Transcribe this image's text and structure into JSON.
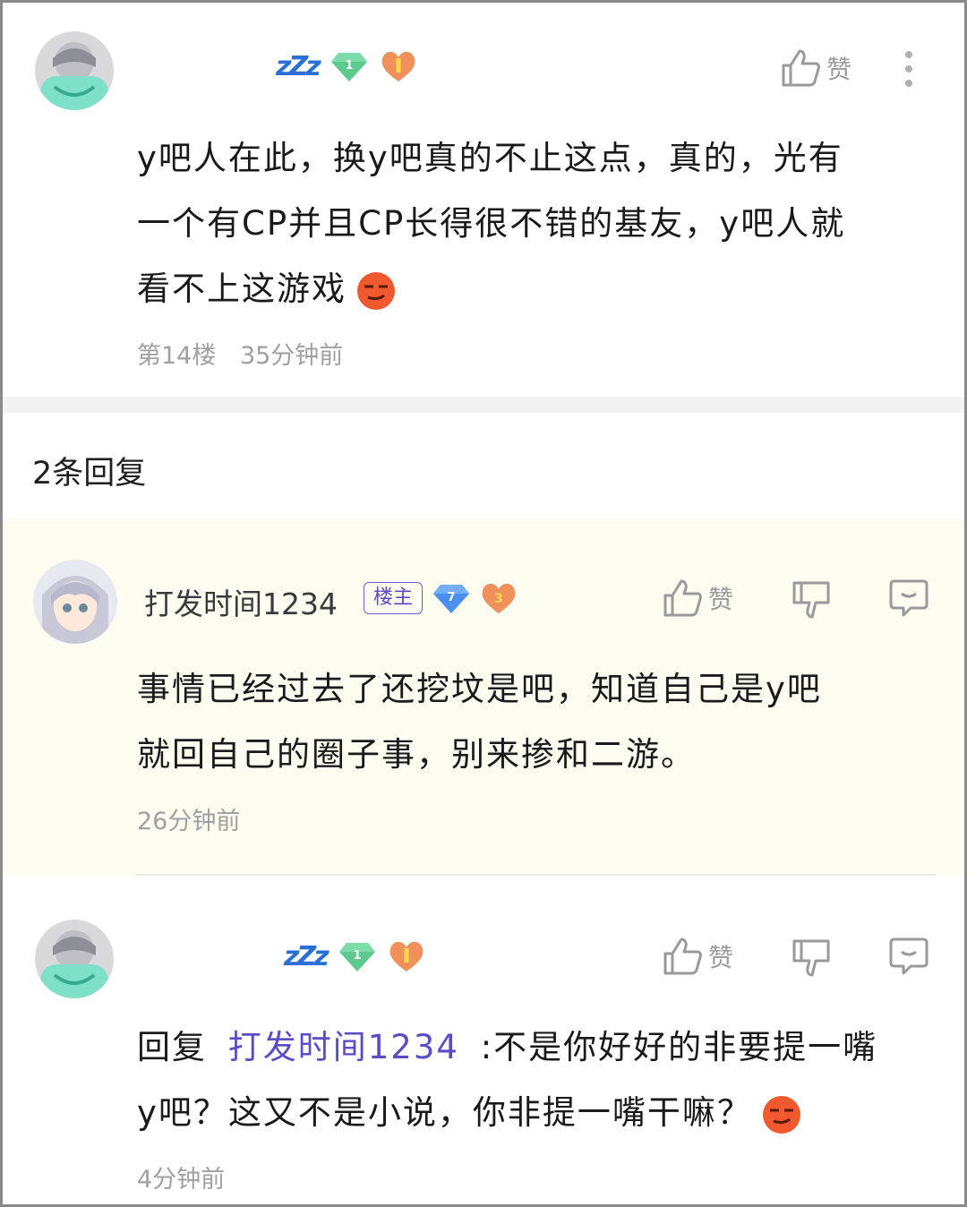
{
  "main_post": {
    "content_lines": [
      "y吧人在此，换y吧真的不止这点，真的，光有",
      "一个有CP并且CP长得很不错的基友，y吧人就",
      "看不上这游戏"
    ],
    "floor": "第14楼",
    "time": "35分钟前",
    "like_label": "赞",
    "level": "1",
    "status_icon_text": "zZz"
  },
  "reply_section": {
    "count_label": "2条回复"
  },
  "replies": [
    {
      "username": "打发时间1234",
      "owner_tag": "楼主",
      "level": "7",
      "heart_level": "3",
      "like_label": "赞",
      "content_lines": [
        "事情已经过去了还挖坟是吧，知道自己是y吧",
        "就回自己的圈子事，别来掺和二游。"
      ],
      "time": "26分钟前"
    },
    {
      "level": "1",
      "heart_level": "1",
      "status_icon_text": "zZz",
      "like_label": "赞",
      "reply_prefix": "回复",
      "mention": "打发时间1234",
      "content_line1_rest": ":不是你好好的非要提一嘴",
      "content_line2": "y吧？这又不是小说，你非提一嘴干嘛？",
      "time": "4分钟前"
    }
  ],
  "colors": {
    "accent_purple": "#5a4cc8",
    "meta_gray": "#a0a0a0",
    "highlight_bg": "#fcfcf1"
  },
  "icons": [
    "thumbs-up-icon",
    "thumbs-down-icon",
    "comment-icon",
    "more-icon",
    "gem-level-icon",
    "heart-level-icon",
    "emoji-smirk-icon"
  ]
}
